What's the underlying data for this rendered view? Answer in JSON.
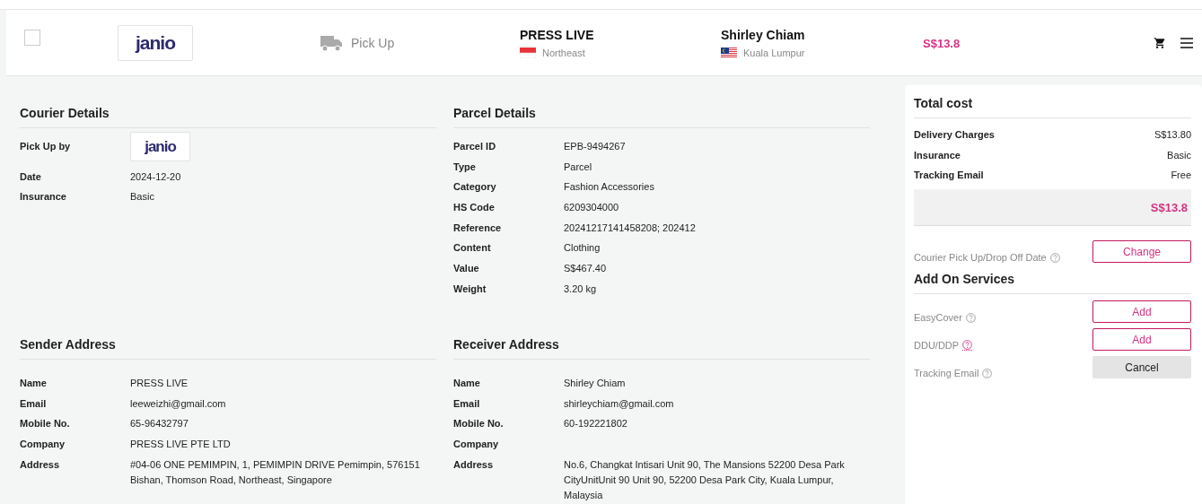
{
  "order_row": {
    "selected": false,
    "logo": "janio",
    "method": "Pick Up",
    "sender": {
      "name": "PRESS LIVE",
      "region": "Northeast"
    },
    "receiver": {
      "name": "Shirley Chiam",
      "region": "Kuala Lumpur"
    },
    "price": "S$13.8"
  },
  "sections": [
    {
      "title": "Courier Details",
      "rows": [
        {
          "label": "Pick Up by",
          "kind": "logo",
          "value": "janio"
        },
        {
          "label": "Date",
          "kind": "text",
          "value": "2024-12-20"
        },
        {
          "label": "Insurance",
          "kind": "text",
          "value": "Basic"
        }
      ]
    },
    {
      "title": "Parcel Details",
      "rows": [
        {
          "label": "Parcel ID",
          "kind": "text",
          "value": "EPB-9494267"
        },
        {
          "label": "Type",
          "kind": "text",
          "value": "Parcel"
        },
        {
          "label": "Category",
          "kind": "text",
          "value": "Fashion Accessories"
        },
        {
          "label": "HS Code",
          "kind": "text",
          "value": "6209304000"
        },
        {
          "label": "Reference",
          "kind": "text",
          "value": "20241217141458208; 202412"
        },
        {
          "label": "Content",
          "kind": "text",
          "value": "Clothing"
        },
        {
          "label": "Value",
          "kind": "text",
          "value": "S$467.40"
        },
        {
          "label": "Weight",
          "kind": "text",
          "value": "3.20 kg"
        }
      ]
    },
    {
      "title": "Sender Address",
      "rows": [
        {
          "label": "Name",
          "kind": "text",
          "value": "PRESS LIVE"
        },
        {
          "label": "Email",
          "kind": "text",
          "value": "leeweizhi@gmail.com"
        },
        {
          "label": "Mobile No.",
          "kind": "text",
          "value": "65-96432797"
        },
        {
          "label": "Company",
          "kind": "text",
          "value": "PRESS LIVE PTE LTD"
        },
        {
          "label": "Address",
          "kind": "text",
          "value": "#04-06 ONE PEMIMPIN, 1, PEMIMPIN DRIVE Pemimpin, 576151 Bishan, Thomson Road, Northeast, Singapore"
        }
      ]
    },
    {
      "title": "Receiver Address",
      "rows": [
        {
          "label": "Name",
          "kind": "text",
          "value": "Shirley Chiam"
        },
        {
          "label": "Email",
          "kind": "text",
          "value": "shirleychiam@gmail.com"
        },
        {
          "label": "Mobile No.",
          "kind": "text",
          "value": "60-192221802"
        },
        {
          "label": "Company"
        },
        {
          "label": "Address",
          "kind": "text",
          "value": "No.6, Changkat Intisari Unit 90, The Mansions 52200 Desa Park CityUnitUnit 90 Unit 90, 52200 Desa Park City, Kuala Lumpur, Malaysia"
        }
      ]
    }
  ],
  "cost_panel": {
    "title": "Total cost",
    "lines": [
      {
        "label": "Delivery Charges",
        "value": "S$13.80"
      },
      {
        "label": "Insurance",
        "value": "Basic"
      },
      {
        "label": "Tracking Email",
        "value": "Free"
      }
    ],
    "total": "S$13.8",
    "date_option": {
      "label": "Courier Pick Up/Drop Off Date",
      "button": "Change",
      "kind": "outline",
      "help_active": false
    },
    "addons_title": "Add On Services",
    "addons": [
      {
        "label": "EasyCover",
        "button": "Add",
        "kind": "outline",
        "help_active": false
      },
      {
        "label": "DDU/DDP",
        "button": "Add",
        "kind": "outline",
        "help_active": true
      },
      {
        "label": "Tracking Email",
        "button": "Cancel",
        "kind": "filled",
        "help_active": false
      }
    ]
  }
}
